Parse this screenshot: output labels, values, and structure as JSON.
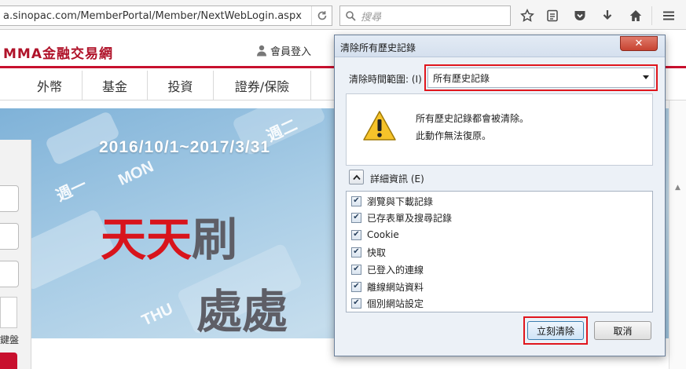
{
  "browser": {
    "url": "a.sinopac.com/MemberPortal/Member/NextWebLogin.aspx",
    "search_placeholder": "搜尋"
  },
  "page": {
    "brand": "MMA金融交易網",
    "member_login": "會員登入",
    "nav": [
      "外幣",
      "基金",
      "投資",
      "證券/保險"
    ],
    "banner": {
      "date": "2016/10/1~2017/3/31",
      "line1": "天天刷",
      "line2": "處處",
      "tags": [
        "週一",
        "週二",
        "THU",
        "MON"
      ]
    },
    "keyboard_label": "鍵盤"
  },
  "dialog": {
    "title": "清除所有歷史記錄",
    "close_symbol": "✕",
    "range_label": "清除時間範圍: (I)",
    "range_value": "所有歷史記錄",
    "warning_line1": "所有歷史記錄都會被清除。",
    "warning_line2": "此動作無法復原。",
    "details_label": "詳細資訊 (E)",
    "items": [
      {
        "label": "瀏覽與下載記錄",
        "checked": true
      },
      {
        "label": "已存表單及搜尋記錄",
        "checked": true
      },
      {
        "label": "Cookie",
        "checked": true
      },
      {
        "label": "快取",
        "checked": true
      },
      {
        "label": "已登入的連線",
        "checked": true
      },
      {
        "label": "離線網站資料",
        "checked": true
      },
      {
        "label": "個別網站設定",
        "checked": true
      }
    ],
    "clear_button": "立刻清除",
    "cancel_button": "取消"
  },
  "colors": {
    "brand_red": "#c8102e",
    "highlight_red": "#e0161d",
    "dialog_bg": "#ecf1f7"
  }
}
